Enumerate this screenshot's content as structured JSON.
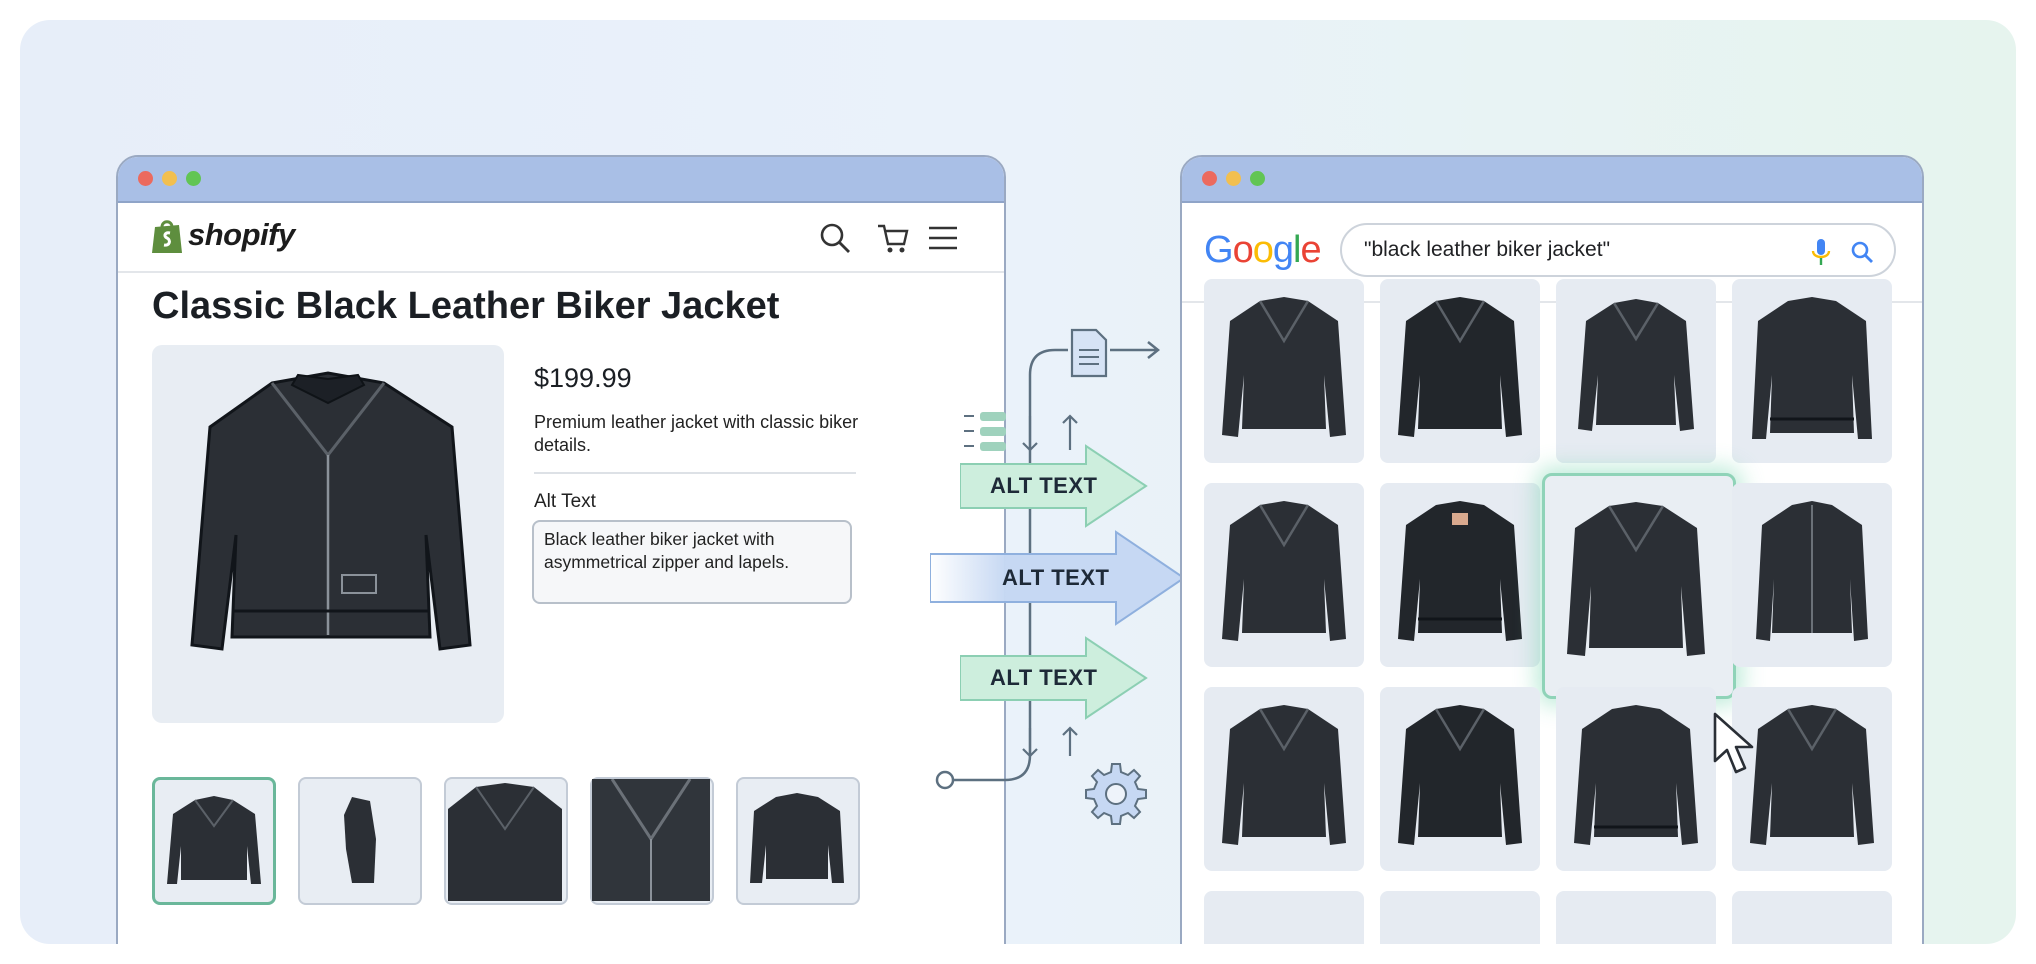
{
  "shop": {
    "logo_text": "shopify",
    "product_title": "Classic Black Leather Biker Jacket",
    "price": "$199.99",
    "description": "Premium leather jacket with classic biker details.",
    "alt_label": "Alt Text",
    "alt_value": "Black leather biker jacket with asymmetrical zipper and lapels.",
    "thumbnails": [
      "front",
      "side",
      "closeup",
      "collar",
      "back"
    ]
  },
  "flow": {
    "arrow_labels": [
      "ALT TEXT",
      "ALT TEXT",
      "ALT TEXT"
    ]
  },
  "google": {
    "logo": "Google",
    "query": "\"black leather biker jacket\""
  },
  "colors": {
    "accent_green": "#6ab79a",
    "titlebar": "#a9bfe6",
    "arrow_green": "#cdeedd",
    "arrow_blue": "#c6d8f3"
  },
  "icons": [
    "shopify-bag-icon",
    "search-icon",
    "cart-icon",
    "menu-icon",
    "document-icon",
    "list-icon",
    "gear-icon",
    "mic-icon",
    "cursor-icon"
  ]
}
